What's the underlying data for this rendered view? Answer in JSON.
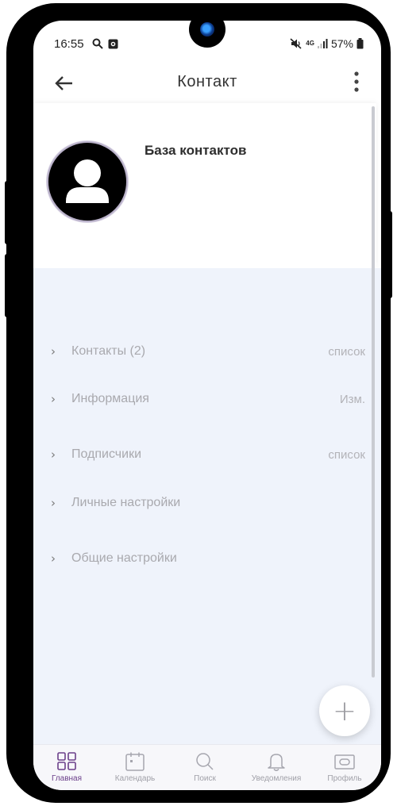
{
  "status_bar": {
    "time": "16:55",
    "network": "4G",
    "battery": "57%"
  },
  "app_bar": {
    "title": "Контакт"
  },
  "contact": {
    "name": "База контактов"
  },
  "list": [
    {
      "label": "Контакты (2)",
      "action": "список"
    },
    {
      "label": "Информация",
      "action": "Изм."
    },
    {
      "label": "Подписчики",
      "action": "список"
    },
    {
      "label": "Личные настройки",
      "action": ""
    },
    {
      "label": "Общие настройки",
      "action": ""
    }
  ],
  "fab": {
    "icon": "plus-icon",
    "label": "+"
  },
  "bottom_nav": [
    {
      "label": "Главная",
      "icon": "grid-icon",
      "active": true
    },
    {
      "label": "Календарь",
      "icon": "calendar-icon",
      "active": false
    },
    {
      "label": "Поиск",
      "icon": "search-icon",
      "active": false
    },
    {
      "label": "Уведомления",
      "icon": "bell-icon",
      "active": false
    },
    {
      "label": "Профиль",
      "icon": "profile-card-icon",
      "active": false
    }
  ],
  "colors": {
    "accent": "#6b3f8a",
    "list_background": "#eff3fb",
    "muted_text": "#a9a9ae"
  }
}
